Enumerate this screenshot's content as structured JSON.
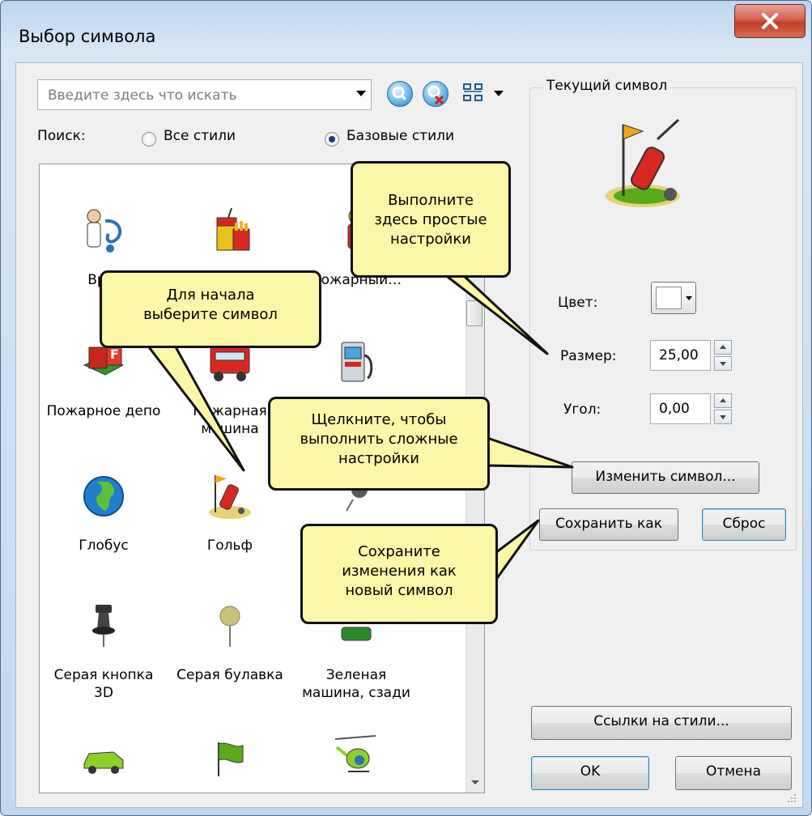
{
  "window": {
    "title": "Выбор символа",
    "close_label": "x"
  },
  "search": {
    "placeholder": "Введите здесь что искать",
    "label": "Поиск:"
  },
  "scope": {
    "all_styles": "Все стили",
    "base_styles": "Базовые стили",
    "selected": "base_styles"
  },
  "gallery": {
    "items": [
      {
        "label": "Вр…",
        "icon": "doctor-icon"
      },
      {
        "label": "",
        "icon": "fast-food-icon"
      },
      {
        "label": "Пожарный…",
        "icon": "firefighter-icon"
      },
      {
        "label": "Пожарное депо",
        "icon": "fire-station-icon"
      },
      {
        "label": "Пожарная машина",
        "icon": "fire-truck-icon"
      },
      {
        "label": "",
        "icon": "gas-station-icon"
      },
      {
        "label": "Глобус",
        "icon": "globe-icon"
      },
      {
        "label": "Гольф",
        "icon": "golf-icon"
      },
      {
        "label": "",
        "icon": "gray-pushpin-icon"
      },
      {
        "label": "Серая кнопка 3D",
        "icon": "gray-push-button-3d-icon"
      },
      {
        "label": "Серая булавка",
        "icon": "gray-pin-icon"
      },
      {
        "label": "Зеленая машина, сзади",
        "icon": "green-car-back-icon"
      },
      {
        "label": "",
        "icon": "green-car-icon"
      },
      {
        "label": "",
        "icon": "green-flag-icon"
      },
      {
        "label": "",
        "icon": "helicopter-icon"
      }
    ]
  },
  "current": {
    "title": "Текущий символ",
    "color_label": "Цвет:",
    "color_value": "#ffffff",
    "size_label": "Размер:",
    "size_value": "25,00",
    "angle_label": "Угол:",
    "angle_value": "0,00",
    "edit_button": "Изменить символ...",
    "saveas_button": "Сохранить как",
    "reset_button": "Сброс"
  },
  "footer": {
    "styles_button": "Ссылки на стили...",
    "ok_button": "OK",
    "cancel_button": "Отмена"
  },
  "callouts": {
    "simple": [
      "Выполните",
      "здесь простые",
      "настройки"
    ],
    "start": [
      "Для начала",
      "выберите символ"
    ],
    "advanced": [
      "Щелкните, чтобы",
      "выполнить сложные",
      "настройки"
    ],
    "save": [
      "Сохраните",
      "изменения как",
      "новый символ"
    ]
  },
  "colors": {
    "callout_fill": "#fbf7a8",
    "accent": "#3c7fb1",
    "close": "#c2402a"
  }
}
